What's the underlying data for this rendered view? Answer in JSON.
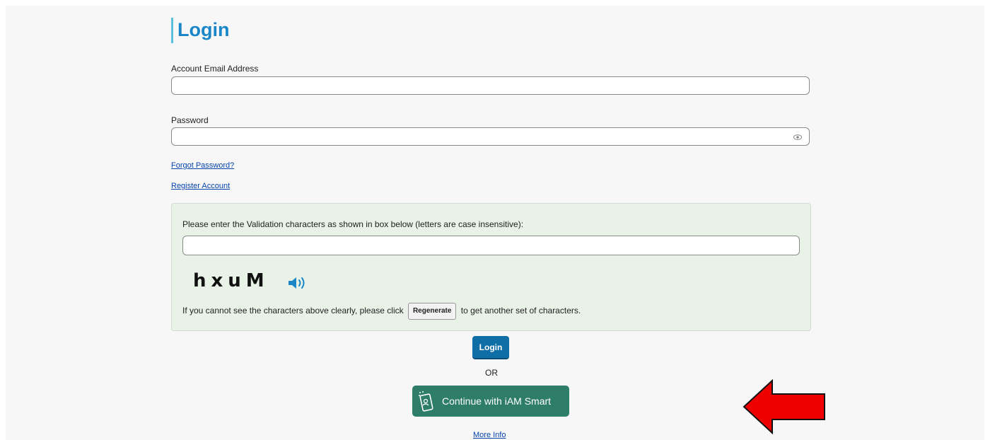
{
  "login": {
    "title": "Login",
    "email_label": "Account Email Address",
    "email_value": "",
    "password_label": "Password",
    "password_value": "",
    "forgot_password": "Forgot Password?",
    "register_account": "Register Account"
  },
  "captcha": {
    "prompt": "Please enter the Validation characters as shown in box below (letters are case insensitive):",
    "value": "",
    "characters": "hxuM",
    "help_before": "If you cannot see the characters above clearly, please click",
    "regenerate_label": "Regenerate",
    "help_after": "to get another set of characters."
  },
  "actions": {
    "login_label": "Login",
    "or_text": "OR",
    "iam_smart_label": "Continue with iAM Smart",
    "more_info": "More Info"
  },
  "icons": {
    "password": "eye-icon",
    "audio": "speaker-icon",
    "iam_smart": "iam-smart-phone-icon",
    "annotation": "red-arrow-icon"
  },
  "colors": {
    "title": "#1a86c8",
    "title_bar": "#5bc0de",
    "link": "#0645ad",
    "captcha_panel": "#e8f2e7",
    "login_button": "#0f6ea6",
    "iam_button": "#2e7d68",
    "arrow": "#ee0000"
  }
}
